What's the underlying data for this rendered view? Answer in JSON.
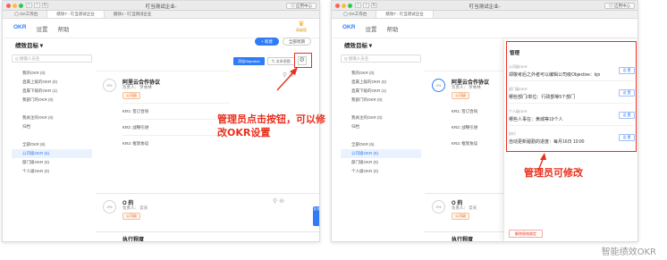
{
  "window": {
    "title": "叮当测试企业-",
    "share_label": "◎ 应用中心",
    "traffic_colors": [
      "#fc605b",
      "#fdbc40",
      "#34c84a"
    ]
  },
  "left_tabs": [
    "◯ OA工作台",
    "绩效7 - 叮当测试企业",
    "绩效1 - 叮当测试企业"
  ],
  "right_tabs": [
    "◯ OA工作台",
    "绩效7 - 叮当测试企业"
  ],
  "app_nav": [
    "OKR",
    "设置",
    "帮助"
  ],
  "upgrade_label": "高级版",
  "main_title": "绩效目标 ▾",
  "header_buttons": {
    "add": "+ 新建",
    "all": "全部周期"
  },
  "search_placeholder": "Q 搜输人员名",
  "sidebar_items": [
    "我的OKR (0)",
    "直属上级的OKR (0)",
    "直属下级的OKR (1)",
    "我部门的OKR (0)",
    "",
    "我关注的OKR (0)",
    "归档",
    "",
    "全部OKR (6)",
    "公司级OKR (6)",
    "部门级OKR (0)",
    "个人级OKR (0)"
  ],
  "toolbar": {
    "objective": "添加Objective",
    "view": "⇅ 关系视图",
    "gear": "⚙"
  },
  "card1": {
    "progress": "0%",
    "title": "阿里云合作协议",
    "owner": "负责人： 罗本林",
    "tag": "公司级",
    "krs": [
      "KR1: 签订合同",
      "KR2: 战略引进",
      "KR3: 框架协议"
    ],
    "icons": "⚲ ⊖"
  },
  "card2": {
    "progress": "0%",
    "title": "O 的",
    "owner": "负责人： 云天",
    "tag": "公司级",
    "icons": "⚲ ⊖"
  },
  "card3": {
    "title": "执行程度"
  },
  "annotation_left": "管理员点击按钮，可以修改OKR设置",
  "annotation_right": "管理员可修改",
  "floating_tab": "反馈",
  "panel": {
    "title": "管理",
    "sections": [
      {
        "label": "公司级OKR",
        "value": "郑敬考后之外者可以编辑公司级Objective：kjn",
        "button": "设 置"
      },
      {
        "label": "部门级OKR",
        "value": "哪些部门/单位：行政部等5个部门",
        "button": "设 置"
      },
      {
        "label": "个人级OKR",
        "value": "哪些人事在：黄城等19个人",
        "button": "设 置"
      },
      {
        "label": "执行",
        "value": "自动更新履勤的进度：每月16日 10:00",
        "button": "设 置"
      }
    ],
    "unbind": "解除绩效绑定"
  },
  "watermark": "智能绩效OKR"
}
